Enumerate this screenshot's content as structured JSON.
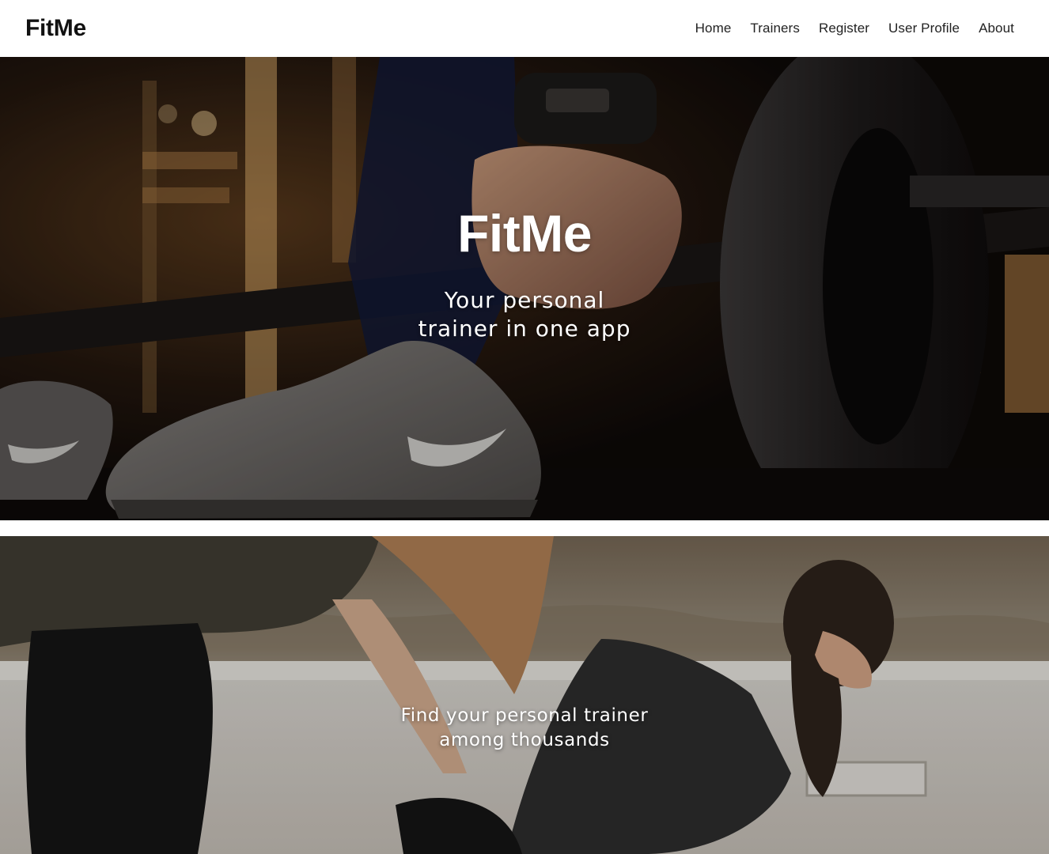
{
  "header": {
    "brand": "FitMe",
    "nav": [
      "Home",
      "Trainers",
      "Register",
      "User Profile",
      "About"
    ]
  },
  "hero": {
    "title": "FitMe",
    "subtitle": "Your personal trainer in one app",
    "image_description": "gym-barbell-photo"
  },
  "feature": {
    "text": "Find your personal trainer among thousands",
    "image_description": "stretching-trainers-photo"
  }
}
